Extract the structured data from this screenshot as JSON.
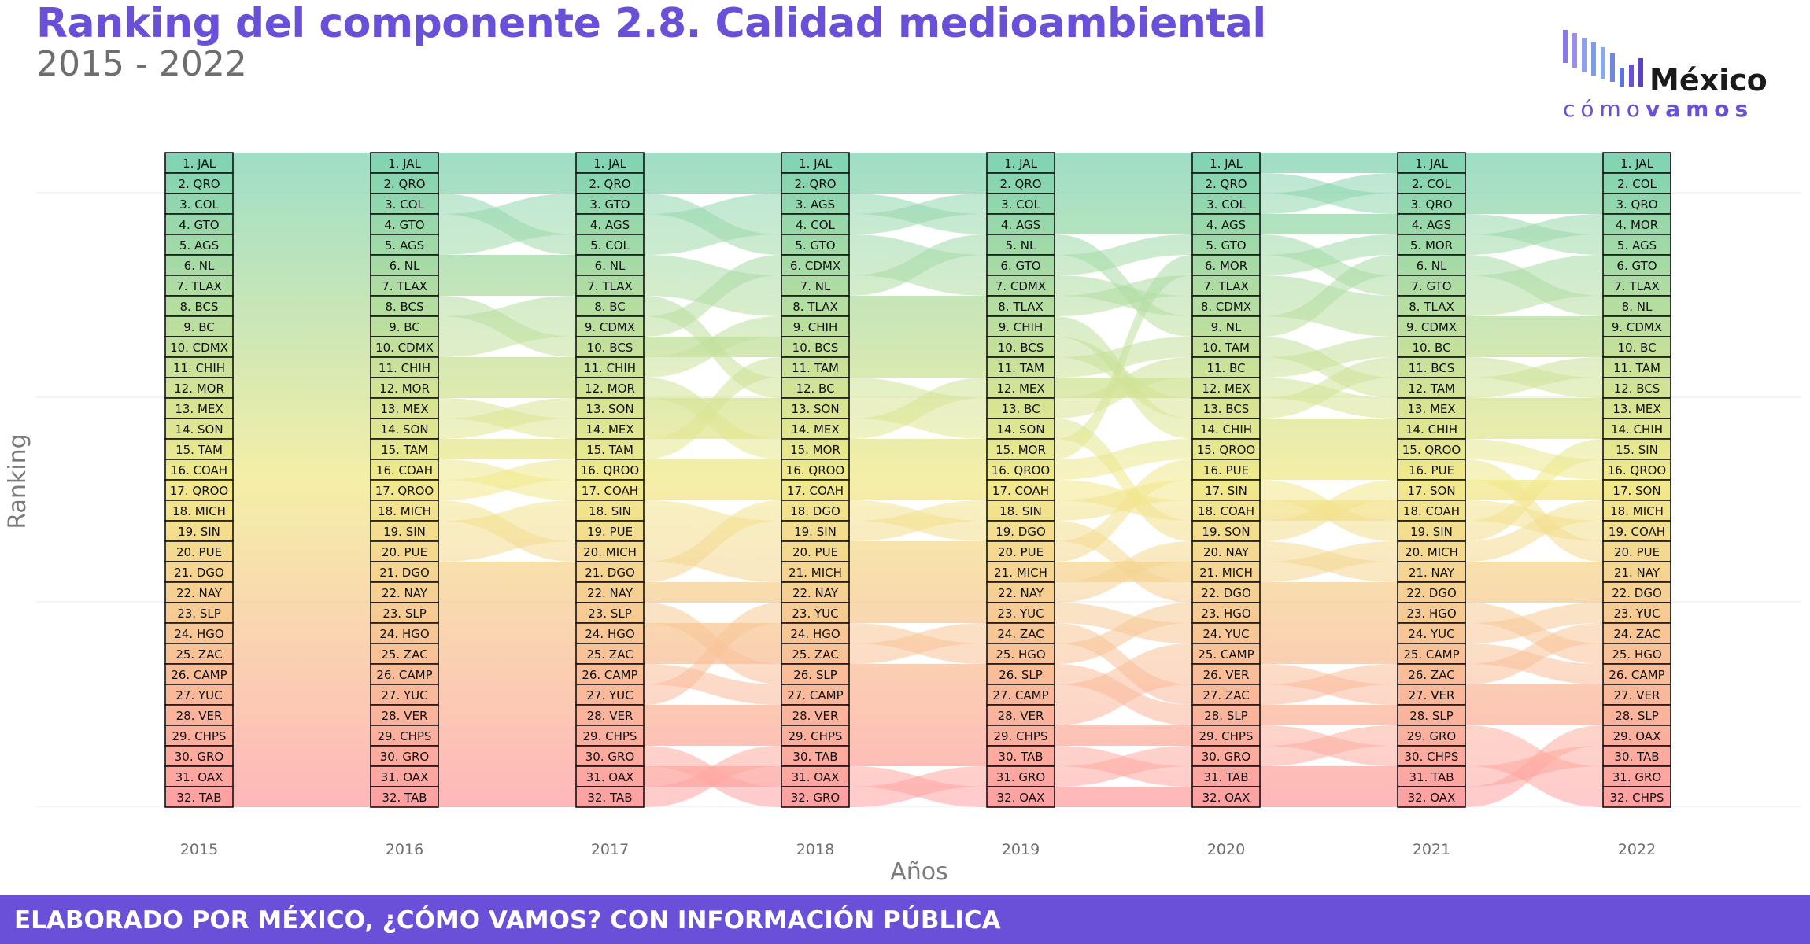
{
  "header": {
    "title": "Ranking del componente 2.8. Calidad medioambiental",
    "subtitle": "2015 - 2022"
  },
  "logo": {
    "word1": "México",
    "word2a": "cómo",
    "word2b": "vamos"
  },
  "footer": {
    "text": "ELABORADO POR MÉXICO, ¿CÓMO VAMOS? CON INFORMACIÓN PÚBLICA"
  },
  "colors": {
    "title": "#6a4fd8",
    "footer_bg": "#6a4fd8",
    "rank_top": "#7fd3b4",
    "rank_mid": "#f1e98a",
    "rank_bottom": "#ff9fa3"
  },
  "chart_data": {
    "type": "bump",
    "ylabel": "Ranking",
    "xlabel": "Años",
    "years": [
      "2015",
      "2016",
      "2017",
      "2018",
      "2019",
      "2020",
      "2021",
      "2022"
    ],
    "ranking": {
      "2015": [
        "JAL",
        "QRO",
        "COL",
        "GTO",
        "AGS",
        "NL",
        "TLAX",
        "BCS",
        "BC",
        "CDMX",
        "CHIH",
        "MOR",
        "MEX",
        "SON",
        "TAM",
        "COAH",
        "QROO",
        "MICH",
        "SIN",
        "PUE",
        "DGO",
        "NAY",
        "SLP",
        "HGO",
        "ZAC",
        "CAMP",
        "YUC",
        "VER",
        "CHPS",
        "GRO",
        "OAX",
        "TAB"
      ],
      "2016": [
        "JAL",
        "QRO",
        "COL",
        "GTO",
        "AGS",
        "NL",
        "TLAX",
        "BCS",
        "BC",
        "CDMX",
        "CHIH",
        "MOR",
        "MEX",
        "SON",
        "TAM",
        "COAH",
        "QROO",
        "MICH",
        "SIN",
        "PUE",
        "DGO",
        "NAY",
        "SLP",
        "HGO",
        "ZAC",
        "CAMP",
        "YUC",
        "VER",
        "CHPS",
        "GRO",
        "OAX",
        "TAB"
      ],
      "2017": [
        "JAL",
        "QRO",
        "GTO",
        "AGS",
        "COL",
        "NL",
        "TLAX",
        "BC",
        "CDMX",
        "BCS",
        "CHIH",
        "MOR",
        "SON",
        "MEX",
        "TAM",
        "QROO",
        "COAH",
        "SIN",
        "PUE",
        "MICH",
        "DGO",
        "NAY",
        "SLP",
        "HGO",
        "ZAC",
        "CAMP",
        "YUC",
        "VER",
        "CHPS",
        "GRO",
        "OAX",
        "TAB"
      ],
      "2018": [
        "JAL",
        "QRO",
        "AGS",
        "COL",
        "GTO",
        "CDMX",
        "NL",
        "TLAX",
        "CHIH",
        "BCS",
        "TAM",
        "BC",
        "SON",
        "MEX",
        "MOR",
        "QROO",
        "COAH",
        "DGO",
        "SIN",
        "PUE",
        "MICH",
        "NAY",
        "YUC",
        "HGO",
        "ZAC",
        "SLP",
        "CAMP",
        "VER",
        "CHPS",
        "TAB",
        "OAX",
        "GRO"
      ],
      "2019": [
        "JAL",
        "QRO",
        "COL",
        "AGS",
        "NL",
        "GTO",
        "CDMX",
        "TLAX",
        "CHIH",
        "BCS",
        "TAM",
        "MEX",
        "BC",
        "SON",
        "MOR",
        "QROO",
        "COAH",
        "SIN",
        "DGO",
        "PUE",
        "MICH",
        "NAY",
        "YUC",
        "ZAC",
        "HGO",
        "SLP",
        "CAMP",
        "VER",
        "CHPS",
        "TAB",
        "GRO",
        "OAX"
      ],
      "2020": [
        "JAL",
        "QRO",
        "COL",
        "AGS",
        "GTO",
        "MOR",
        "TLAX",
        "CDMX",
        "NL",
        "TAM",
        "BC",
        "MEX",
        "BCS",
        "CHIH",
        "QROO",
        "PUE",
        "SIN",
        "COAH",
        "SON",
        "NAY",
        "MICH",
        "DGO",
        "HGO",
        "YUC",
        "CAMP",
        "VER",
        "ZAC",
        "SLP",
        "CHPS",
        "GRO",
        "TAB",
        "OAX"
      ],
      "2021": [
        "JAL",
        "COL",
        "QRO",
        "AGS",
        "MOR",
        "NL",
        "GTO",
        "TLAX",
        "CDMX",
        "BC",
        "BCS",
        "TAM",
        "MEX",
        "CHIH",
        "QROO",
        "PUE",
        "SON",
        "COAH",
        "SIN",
        "MICH",
        "NAY",
        "DGO",
        "HGO",
        "YUC",
        "CAMP",
        "ZAC",
        "VER",
        "SLP",
        "GRO",
        "CHPS",
        "TAB",
        "OAX"
      ],
      "2022": [
        "JAL",
        "COL",
        "QRO",
        "MOR",
        "AGS",
        "GTO",
        "TLAX",
        "NL",
        "CDMX",
        "BC",
        "TAM",
        "BCS",
        "MEX",
        "CHIH",
        "SIN",
        "QROO",
        "SON",
        "MICH",
        "COAH",
        "PUE",
        "NAY",
        "DGO",
        "YUC",
        "ZAC",
        "HGO",
        "CAMP",
        "VER",
        "SLP",
        "OAX",
        "TAB",
        "GRO",
        "CHPS"
      ]
    }
  }
}
